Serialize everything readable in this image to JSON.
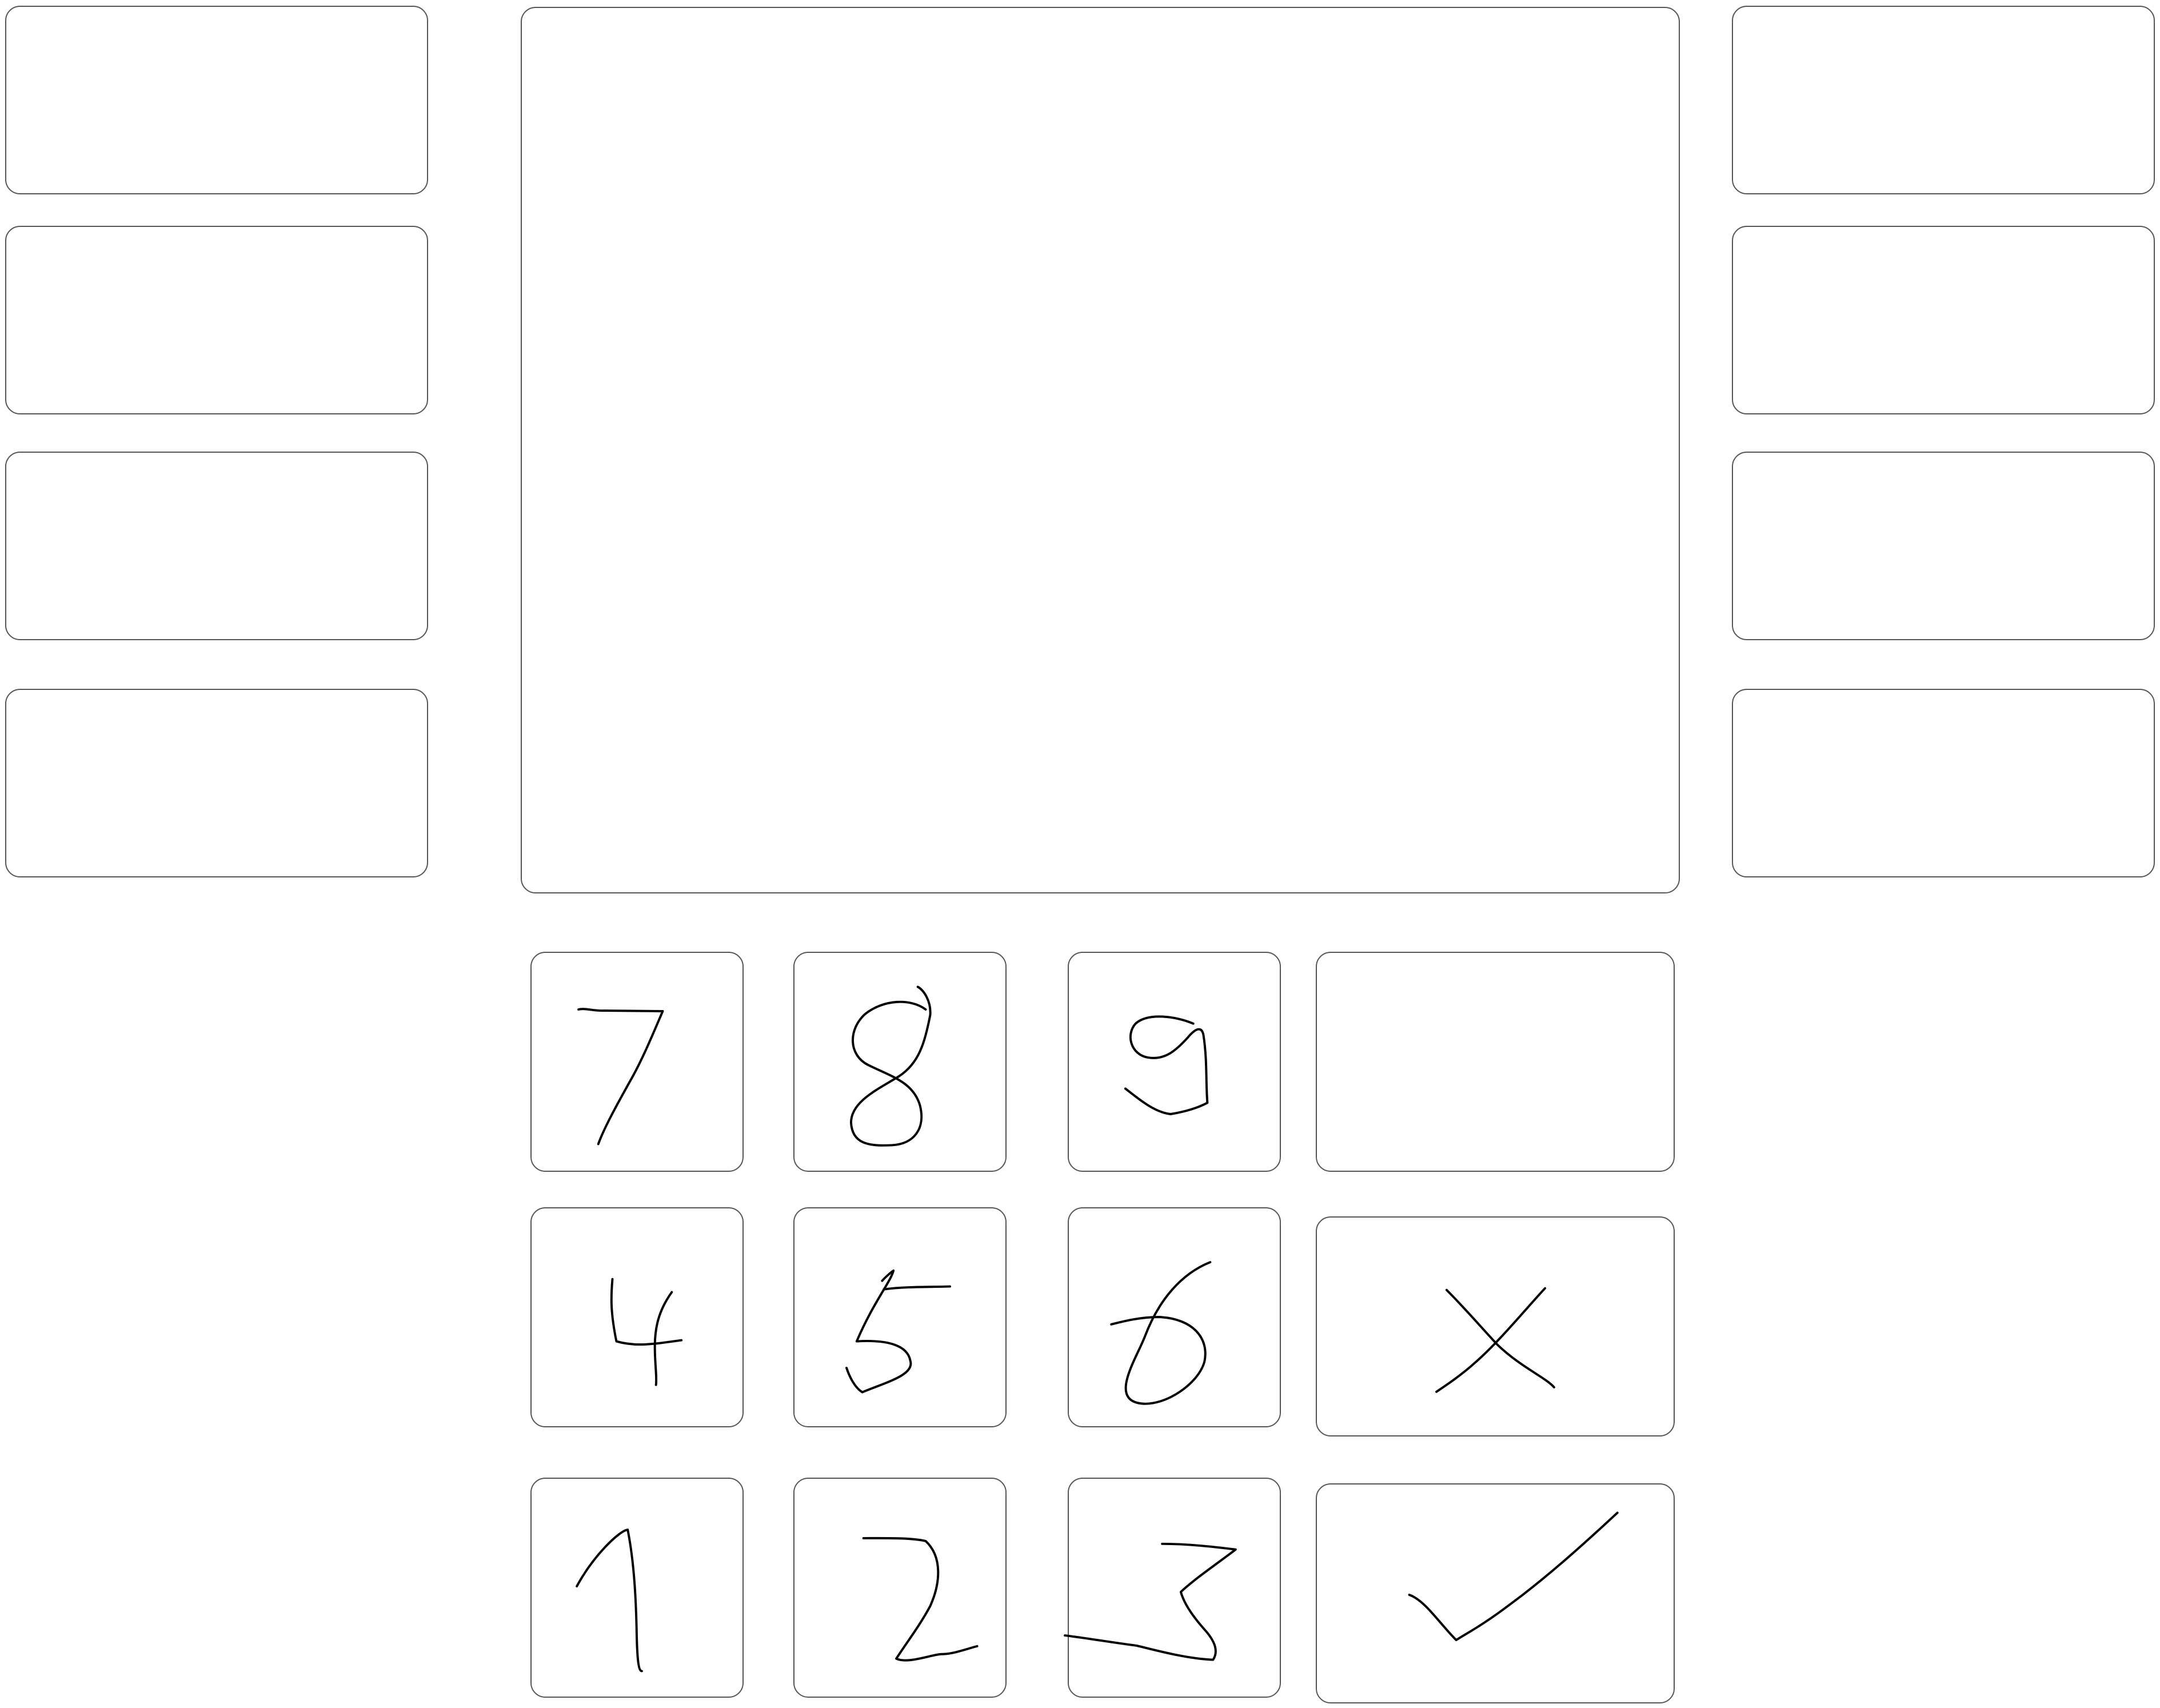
{
  "screen": {},
  "left_buttons": [
    {
      "label": ""
    },
    {
      "label": ""
    },
    {
      "label": ""
    },
    {
      "label": ""
    }
  ],
  "right_buttons": [
    {
      "label": ""
    },
    {
      "label": ""
    },
    {
      "label": ""
    },
    {
      "label": ""
    }
  ],
  "keypad": {
    "keys": [
      {
        "label": "7"
      },
      {
        "label": "8"
      },
      {
        "label": "9"
      },
      {
        "label": "4"
      },
      {
        "label": "5"
      },
      {
        "label": "6"
      },
      {
        "label": "1"
      },
      {
        "label": "2"
      },
      {
        "label": "3"
      }
    ],
    "blank_key": {
      "label": ""
    },
    "cancel_icon": "x-icon",
    "confirm_icon": "checkmark-icon"
  }
}
